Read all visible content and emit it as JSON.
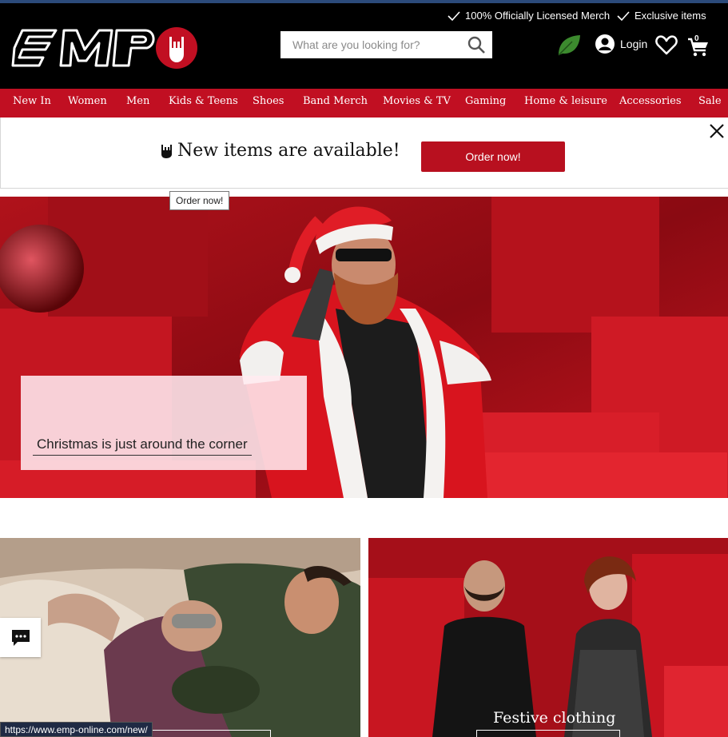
{
  "header": {
    "usp_1": "100% Officially Licensed Merch",
    "usp_2": "Exclusive items",
    "logo_text": "EMP",
    "search_placeholder": "What are you looking for?",
    "login_label": "Login",
    "cart_count": "0"
  },
  "nav": {
    "items": [
      "New In",
      "Women",
      "Men",
      "Kids & Teens",
      "Shoes",
      "Band Merch",
      "Movies & TV",
      "Gaming",
      "Home & leisure",
      "Accessories",
      "Sale"
    ]
  },
  "notice": {
    "message": "New items are available!",
    "button_label": "Order now!",
    "tooltip": "Order now!"
  },
  "hero": {
    "caption": "Christmas is just around the corner"
  },
  "tiles": {
    "right_title": "Festive clothing"
  },
  "status_bar": {
    "url": "https://www.emp-online.com/new/"
  },
  "colors": {
    "brand_red": "#c10f22",
    "header_bg": "#000000",
    "button_red": "#b8101f"
  }
}
